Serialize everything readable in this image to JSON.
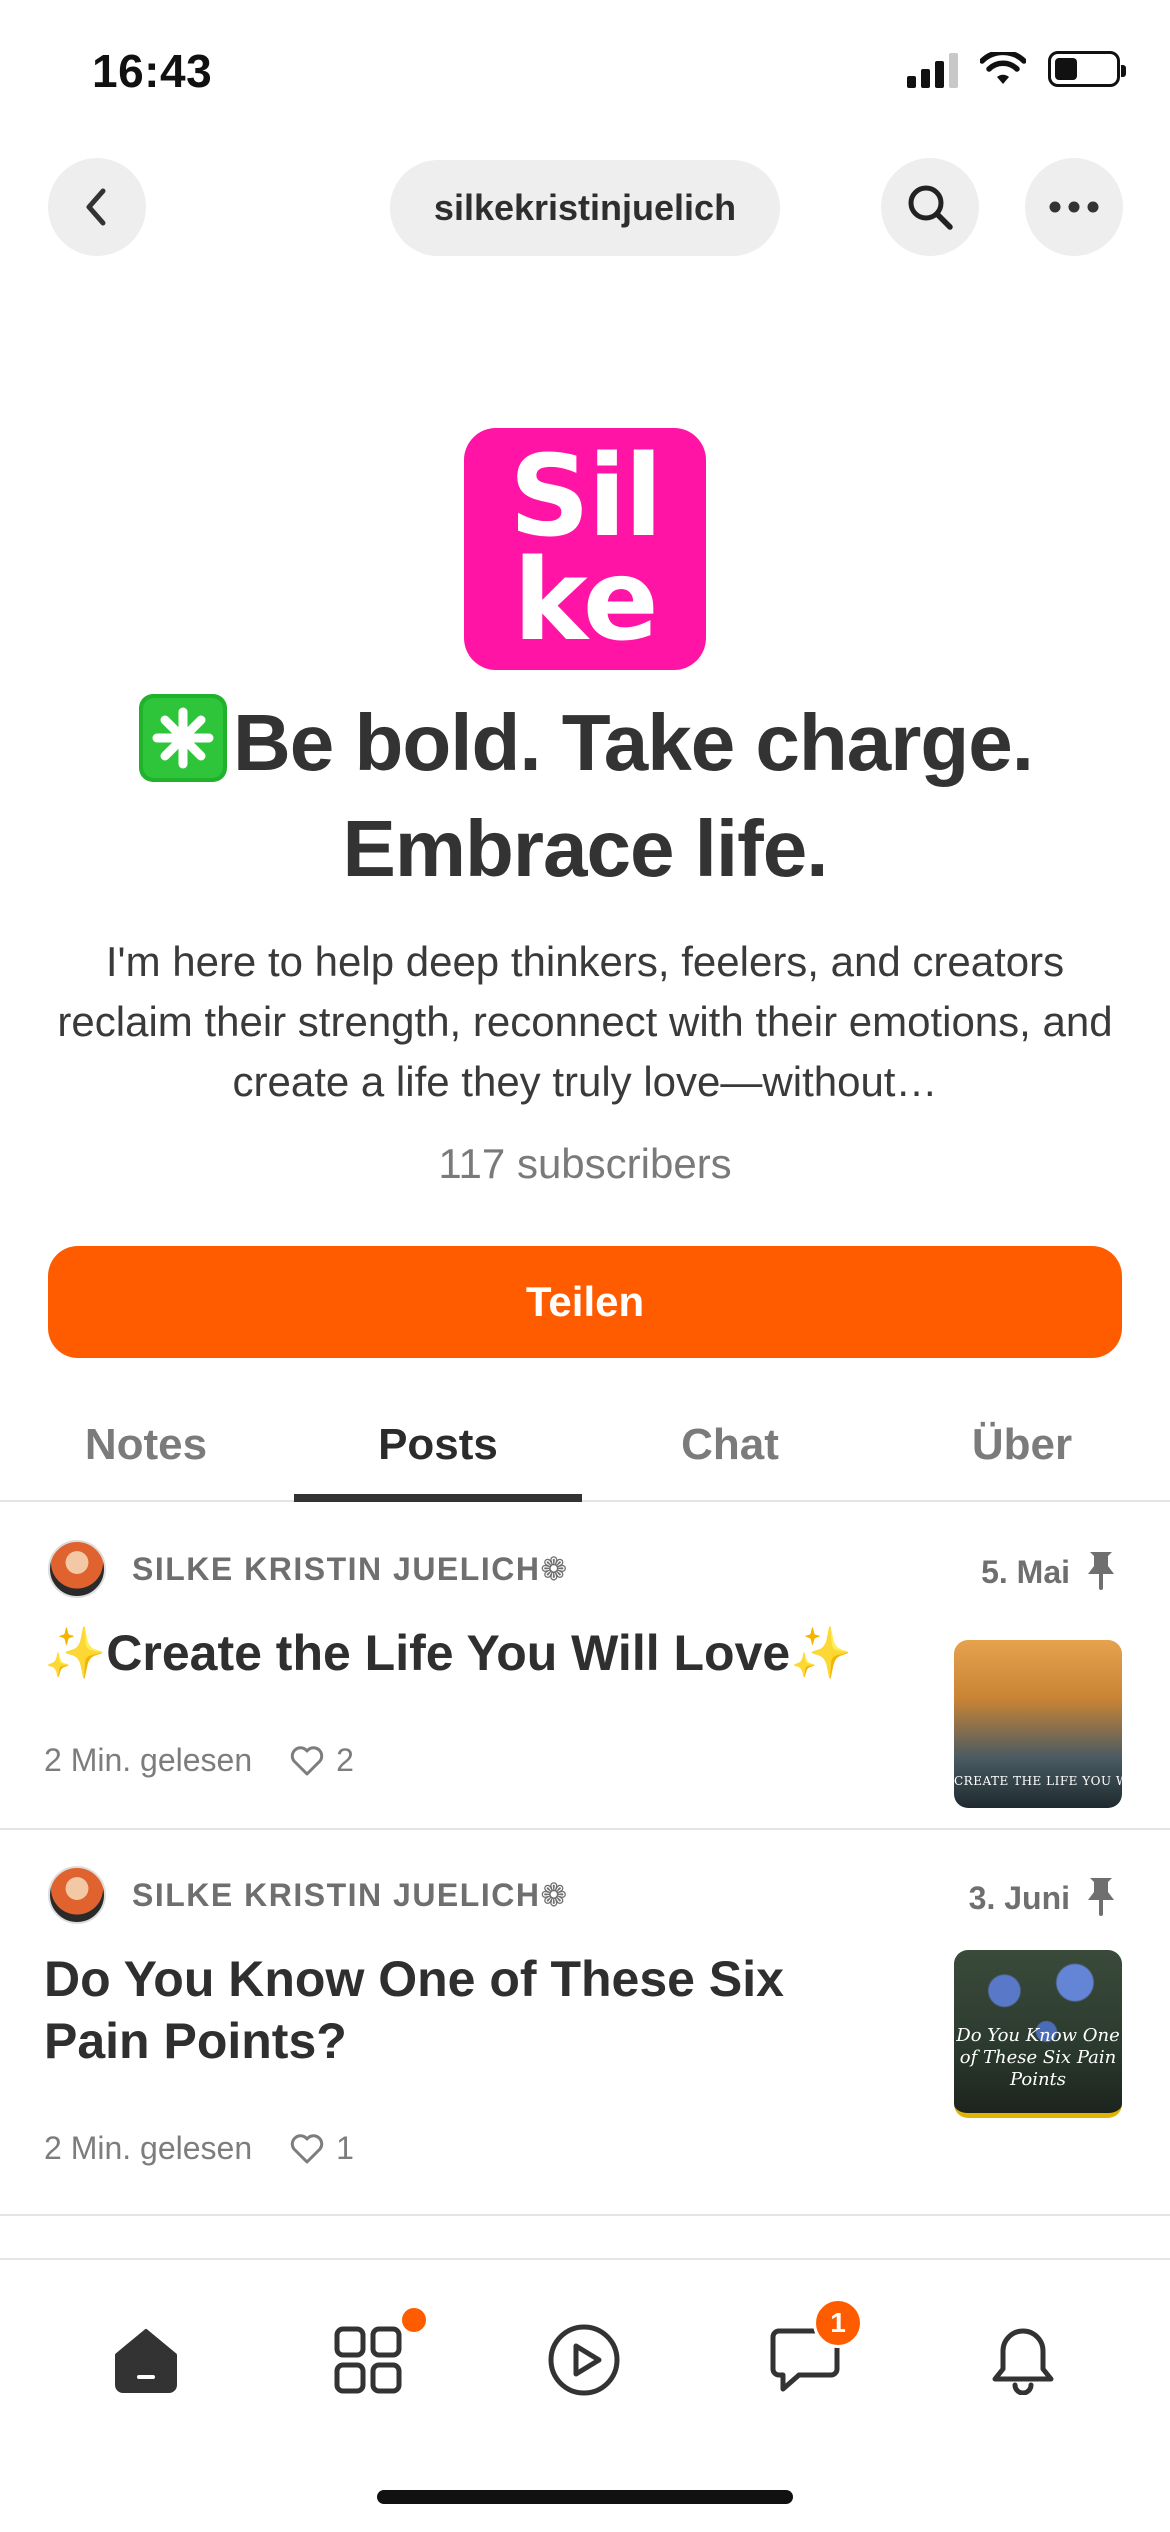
{
  "status_bar": {
    "time": "16:43"
  },
  "nav": {
    "title": "silkekristinjuelich"
  },
  "publication": {
    "logo_lines": [
      "Sil",
      "ke"
    ],
    "headline": "Be bold. Take charge. Embrace life.",
    "bio": "I'm here to help deep thinkers, feelers, and creators reclaim their strength, reconnect with their emotions, and create a life they truly love—without…",
    "subscribers": "117 subscribers",
    "share_label": "Teilen",
    "brand_color": "#ff14a6",
    "accent_color": "#ff5c00"
  },
  "tabs": [
    {
      "label": "Notes",
      "active": false
    },
    {
      "label": "Posts",
      "active": true
    },
    {
      "label": "Chat",
      "active": false
    },
    {
      "label": "Über",
      "active": false
    }
  ],
  "posts": [
    {
      "author": "SILKE KRISTIN JUELICH❁",
      "date": "5. Mai",
      "title": "✨Create the Life You Will Love✨",
      "read_time": "2 Min. gelesen",
      "likes": "2",
      "pinned": true,
      "thumb_text": "CREATE THE LIFE YOU WILL LOVE"
    },
    {
      "author": "SILKE KRISTIN JUELICH❁",
      "date": "3. Juni",
      "title": "Do You Know One of These Six Pain Points?",
      "read_time": "2 Min. gelesen",
      "likes": "1",
      "pinned": true,
      "thumb_text": "Do You Know One of These Six Pain Points"
    }
  ],
  "bottom_nav": {
    "items": [
      "home-icon",
      "grid-icon",
      "play-icon",
      "chat-icon",
      "bell-icon"
    ],
    "chat_badge": "1"
  }
}
